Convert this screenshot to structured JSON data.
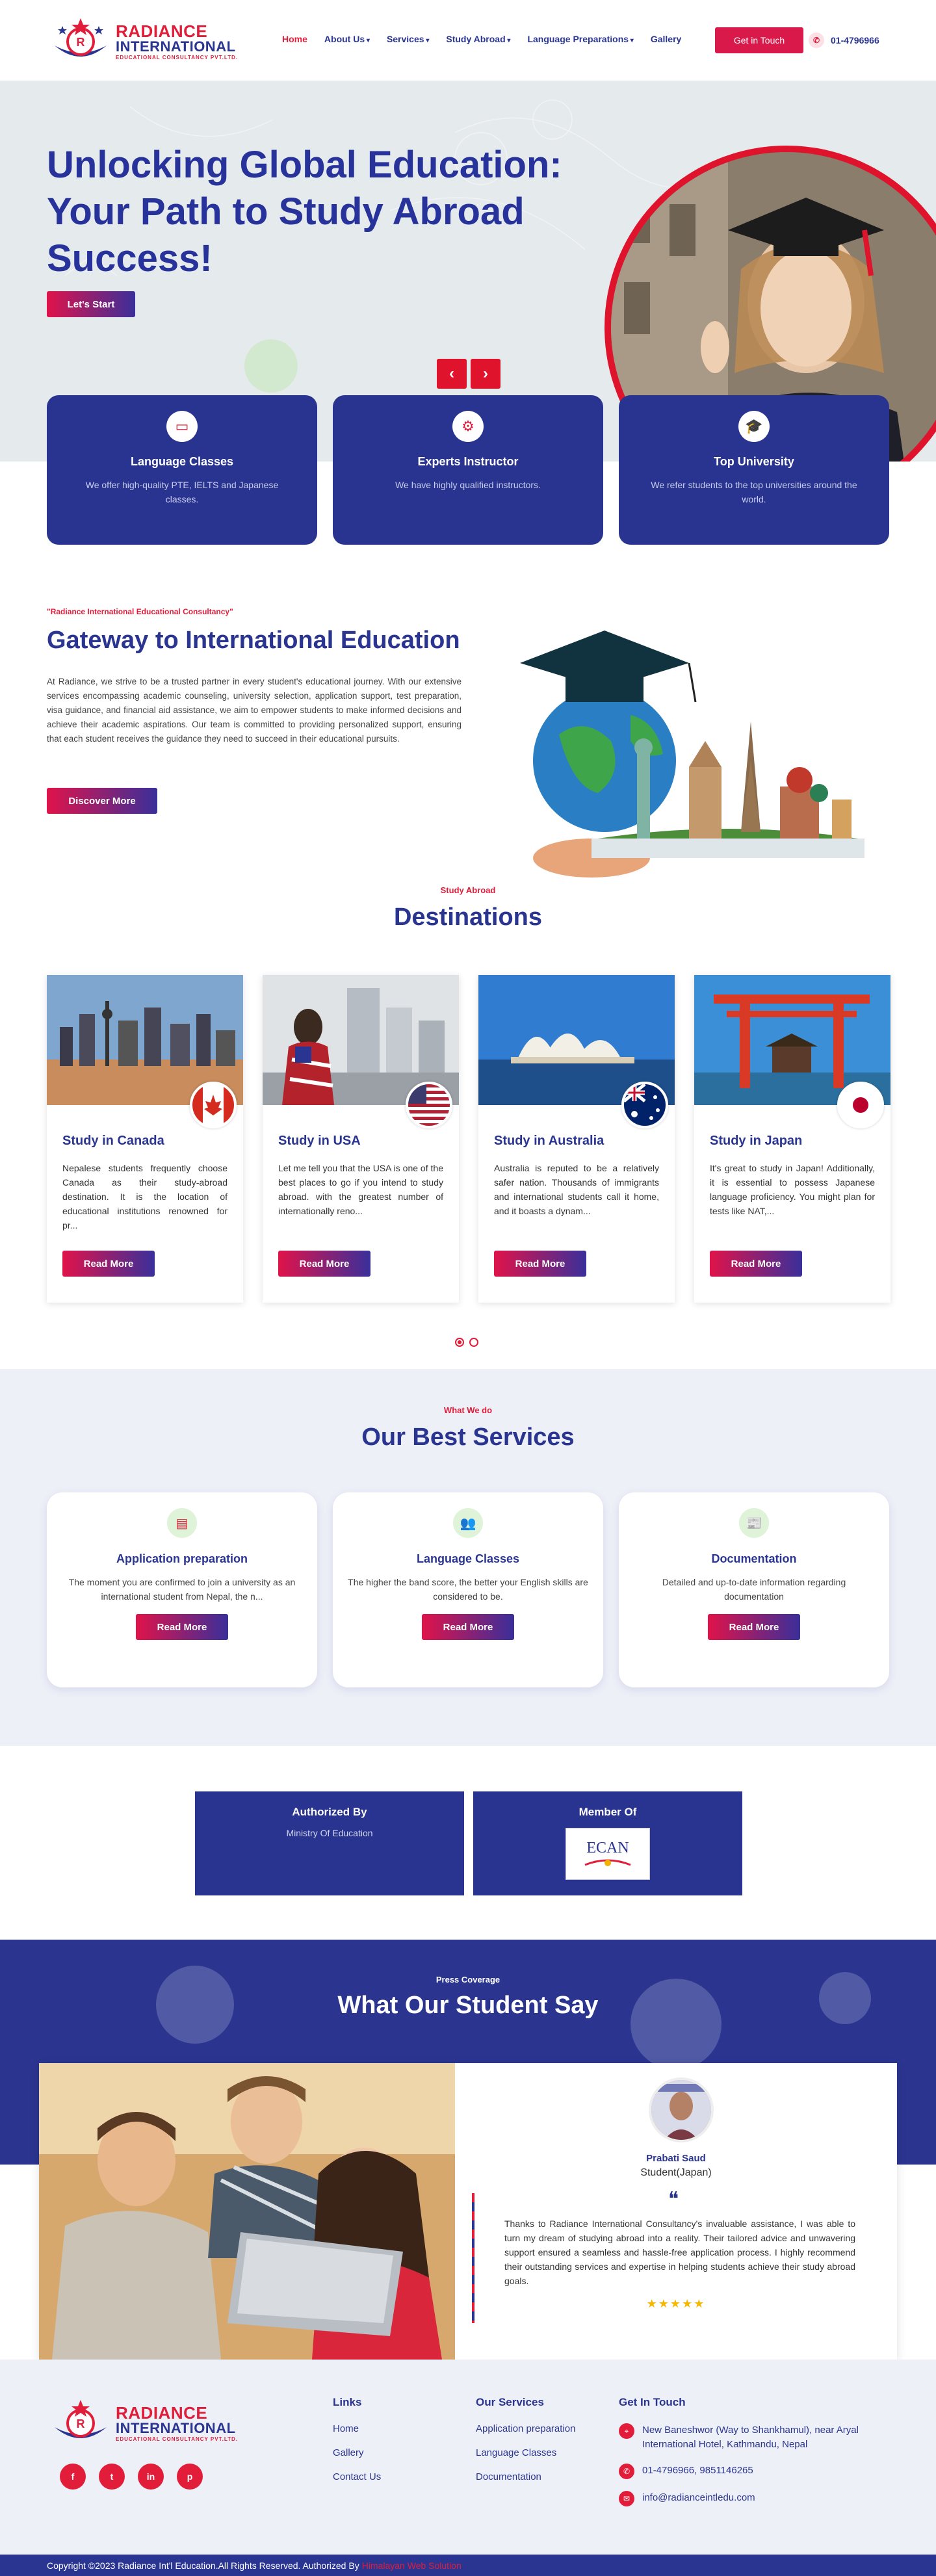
{
  "brand": {
    "name_line1": "RADIANCE",
    "name_line2": "INTERNATIONAL",
    "tagline": "EDUCATIONAL CONSULTANCY PVT.LTD."
  },
  "nav": {
    "items": [
      {
        "label": "Home",
        "active": true,
        "dropdown": false
      },
      {
        "label": "About Us",
        "active": false,
        "dropdown": true
      },
      {
        "label": "Services",
        "active": false,
        "dropdown": true
      },
      {
        "label": "Study Abroad",
        "active": false,
        "dropdown": true
      },
      {
        "label": "Language Preparations",
        "active": false,
        "dropdown": true
      },
      {
        "label": "Gallery",
        "active": false,
        "dropdown": false
      }
    ],
    "cta": "Get in Touch",
    "phone": "01-4796966"
  },
  "hero": {
    "title": "Unlocking Global Education: Your Path to Study Abroad Success!",
    "button": "Let's Start",
    "prev": "‹",
    "next": "›"
  },
  "features": [
    {
      "title": "Language Classes",
      "text": "We offer high-quality PTE, IELTS and Japanese classes.",
      "icon": "monitor-icon"
    },
    {
      "title": "Experts Instructor",
      "text": "We have highly qualified instructors.",
      "icon": "gears-icon"
    },
    {
      "title": "Top University",
      "text": "We refer students to the top universities around the world.",
      "icon": "graduation-cap-icon"
    }
  ],
  "gateway": {
    "eyebrow": "\"Radiance International Educational Consultancy\"",
    "title": "Gateway to International Education",
    "body": "At Radiance, we strive to be a trusted partner in every student's educational journey. With our extensive services encompassing academic counseling, university selection, application support, test preparation, visa guidance, and financial aid assistance, we aim to empower students to make informed decisions and achieve their academic aspirations. Our team is committed to providing personalized support, ensuring that each student receives the guidance they need to succeed in their educational pursuits.",
    "button": "Discover More"
  },
  "destinations": {
    "eyebrow": "Study Abroad",
    "title": "Destinations",
    "read_more": "Read More",
    "cards": [
      {
        "title": "Study in Canada",
        "text": "Nepalese students frequently choose Canada as their study-abroad destination. It is the location of educational institutions renowned for pr...",
        "flag": "canada"
      },
      {
        "title": "Study in USA",
        "text": "Let me tell you that the USA is one of the best places to go if you intend to study abroad. with the greatest number of internationally reno...",
        "flag": "usa"
      },
      {
        "title": "Study in Australia",
        "text": "Australia is reputed to be a relatively safer nation. Thousands of immigrants and international students call it home, and it boasts a dynam...",
        "flag": "australia"
      },
      {
        "title": "Study in Japan",
        "text": "It's great to study in Japan! Additionally, it is essential to possess Japanese language proficiency. You might plan for tests like NAT,...",
        "flag": "japan"
      }
    ]
  },
  "services": {
    "eyebrow": "What We do",
    "title": "Our Best Services",
    "read_more": "Read More",
    "cards": [
      {
        "title": "Application preparation",
        "text": "The moment you are confirmed to join a university as an international student from Nepal, the n...",
        "icon": "document-icon"
      },
      {
        "title": "Language Classes",
        "text": "The higher the band score, the better your English skills are considered to be.",
        "icon": "users-icon"
      },
      {
        "title": "Documentation",
        "text": "Detailed and up-to-date information regarding documentation",
        "icon": "newspaper-icon"
      }
    ]
  },
  "authorized": {
    "title": "Authorized By",
    "text": "Ministry Of Education"
  },
  "member": {
    "title": "Member Of",
    "logo_text": "ECAN"
  },
  "testimonials": {
    "eyebrow": "Press Coverage",
    "title": "What Our Student Say",
    "name": "Prabati Saud",
    "role": "Student(Japan)",
    "quote_mark": "❝",
    "text": "Thanks to Radiance International Consultancy's invaluable assistance, I was able to turn my dream of studying abroad into a reality. Their tailored advice and unwavering support ensured a seamless and hassle-free application process. I highly recommend their outstanding services and expertise in helping students achieve their study abroad goals.",
    "stars": "★★★★★",
    "rating": 5
  },
  "footer": {
    "links_title": "Links",
    "links": [
      "Home",
      "Gallery",
      "Contact Us"
    ],
    "services_title": "Our Services",
    "services": [
      "Application preparation",
      "Language Classes",
      "Documentation"
    ],
    "contact_title": "Get In Touch",
    "address": "New Baneshwor (Way to Shankhamul), near Aryal International Hotel, Kathmandu, Nepal",
    "phones": "01-4796966, 9851146265",
    "email": "info@radianceintledu.com",
    "socials": [
      "f",
      "t",
      "in",
      "p"
    ]
  },
  "copyright": {
    "text": "Copyright ©2023 Radiance Int'l Education.All Rights Reserved. Authorized By",
    "author": "Himalayan Web Solution"
  }
}
